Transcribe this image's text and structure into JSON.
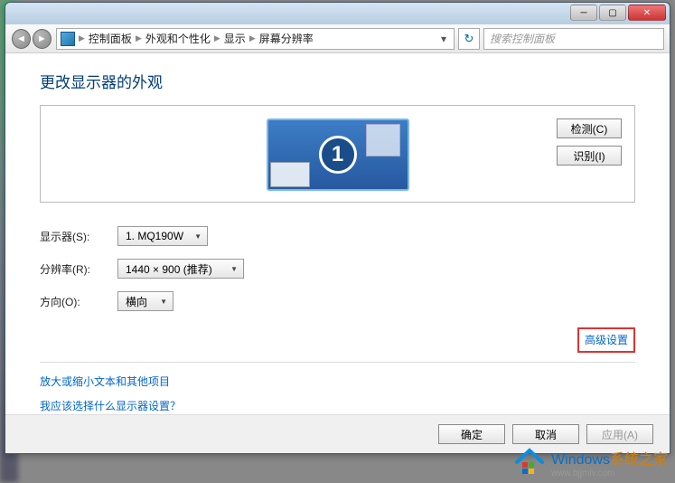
{
  "breadcrumbs": [
    "控制面板",
    "外观和个性化",
    "显示",
    "屏幕分辨率"
  ],
  "search_placeholder": "搜索控制面板",
  "heading": "更改显示器的外观",
  "monitor_number": "1",
  "buttons": {
    "detect": "检测(C)",
    "identify": "识别(I)"
  },
  "fields": {
    "display_label": "显示器(S):",
    "display_value": "1. MQ190W",
    "resolution_label": "分辨率(R):",
    "resolution_value": "1440 × 900 (推荐)",
    "orientation_label": "方向(O):",
    "orientation_value": "横向"
  },
  "adv_link": "高级设置",
  "help_links": {
    "text_size": "放大或缩小文本和其他项目",
    "which_display": "我应该选择什么显示器设置？"
  },
  "dlg": {
    "ok": "确定",
    "cancel": "取消",
    "apply": "应用(A)"
  },
  "watermark": {
    "title_a": "Windows",
    "title_b": "系统之家",
    "url": "www.bjjmlv.com"
  }
}
